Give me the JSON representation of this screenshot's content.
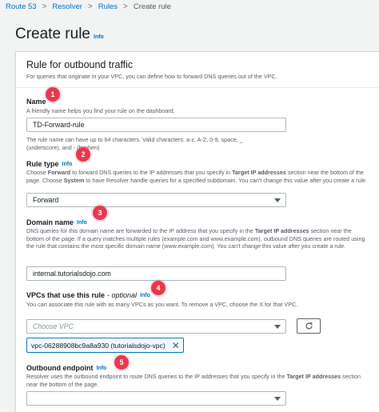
{
  "breadcrumb": {
    "items": [
      "Route 53",
      "Resolver",
      "Rules"
    ],
    "current": "Create rule"
  },
  "page": {
    "title": "Create rule",
    "info": "Info"
  },
  "panel": {
    "title": "Rule for outbound traffic",
    "description": "For queries that originate in your VPC, you can define how to forward DNS queries out of the VPC."
  },
  "name_field": {
    "label": "Name",
    "description": "A friendly name helps you find your rule on the dashboard.",
    "value": "TD-Forward-rule",
    "hint_line1": "The rule name can have up to 64 characters. Valid characters: a-z, A-Z, 0-9, space, _",
    "hint_line2": "(underscore), and - (hyphen)"
  },
  "rule_type": {
    "label": "Rule type",
    "info": "Info",
    "desc_1": "Choose ",
    "desc_b1": "Forward",
    "desc_2": " to forward DNS queries to the IP addresses that you specify in ",
    "desc_b2": "Target IP addresses",
    "desc_3": " section near the bottom of the page. Choose ",
    "desc_b3": "System",
    "desc_4": " to have Resolver handle queries for a specified subdomain. You can't change this value after you create a rule.",
    "value": "Forward"
  },
  "domain_name": {
    "label": "Domain name",
    "info": "Info",
    "desc_1": "DNS queries for this domain name are forwarded to the IP address that you specify in the ",
    "desc_b1": "Target IP addresses",
    "desc_2": " section near the bottom of the page. If a query matches multiple rules (example.com and www.example.com), outbound DNS queries are routed using the rule that contains the most specific domain name (www.example.com). You can't change this value after you create a rule.",
    "value": "internal.tutorialsdojo.com"
  },
  "vpcs": {
    "label": "VPCs that use this rule",
    "optional": "- optional",
    "info": "Info",
    "description": "You can associate this rule with as many VPCs as you want. To remove a VPC, choose the X for that VPC.",
    "placeholder": "Choose VPC",
    "token": "vpc-06288908bc9a8a930 (tutorialsdojo-vpc)"
  },
  "outbound_endpoint": {
    "label": "Outbound endpoint",
    "info": "Info",
    "desc_1": "Resolver uses the outbound endpoint to route DNS queries to the IP addresses that you specify in the ",
    "desc_b1": "Target IP addresses",
    "desc_2": " section near the bottom of the page."
  },
  "badges": [
    "1",
    "2",
    "3",
    "4",
    "5"
  ],
  "colors": {
    "link": "#0073bb",
    "badge": "#e8374e",
    "background": "#f2f3f3"
  },
  "icons": {
    "refresh": "refresh-icon",
    "remove": "close-icon",
    "dropdown": "caret-down-icon"
  }
}
